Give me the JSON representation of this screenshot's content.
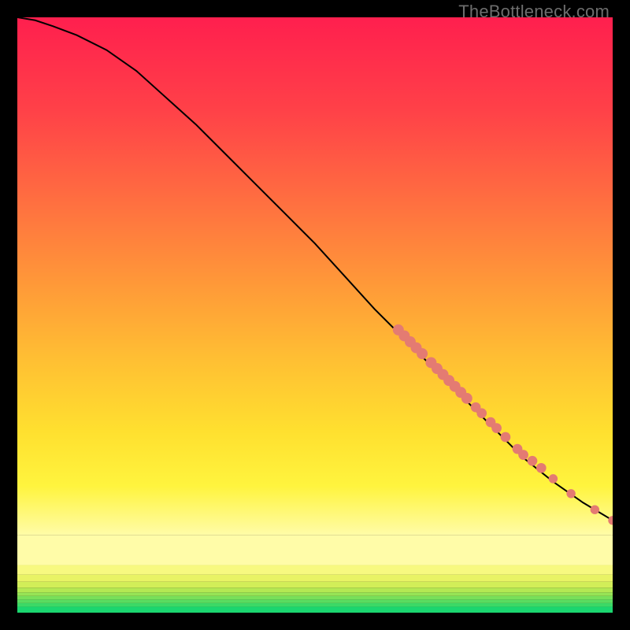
{
  "watermark": "TheBottleneck.com",
  "chart_data": {
    "type": "line",
    "title": "",
    "xlabel": "",
    "ylabel": "",
    "xlim": [
      0,
      100
    ],
    "ylim": [
      0,
      100
    ],
    "grid": false,
    "series": [
      {
        "name": "curve",
        "x": [
          0,
          3,
          6,
          10,
          15,
          20,
          25,
          30,
          35,
          40,
          45,
          50,
          55,
          60,
          65,
          70,
          75,
          80,
          85,
          90,
          95,
          100
        ],
        "y": [
          100,
          99.5,
          98.5,
          97,
          94.5,
          91,
          86.5,
          82,
          77,
          72,
          67,
          62,
          56.5,
          51,
          46,
          41,
          36,
          31,
          26,
          22,
          18.5,
          15.5
        ]
      }
    ],
    "markers": [
      {
        "x": 64,
        "y": 47.5,
        "r": 1.1
      },
      {
        "x": 65,
        "y": 46.5,
        "r": 1.1
      },
      {
        "x": 66,
        "y": 45.5,
        "r": 1.1
      },
      {
        "x": 67,
        "y": 44.5,
        "r": 1.1
      },
      {
        "x": 68,
        "y": 43.5,
        "r": 1.1
      },
      {
        "x": 69.5,
        "y": 42,
        "r": 1.1
      },
      {
        "x": 70.5,
        "y": 41,
        "r": 1.1
      },
      {
        "x": 71.5,
        "y": 40,
        "r": 1.1
      },
      {
        "x": 72.5,
        "y": 39,
        "r": 1.1
      },
      {
        "x": 73.5,
        "y": 38,
        "r": 1.1
      },
      {
        "x": 74.5,
        "y": 37,
        "r": 1.1
      },
      {
        "x": 75.5,
        "y": 36,
        "r": 1.1
      },
      {
        "x": 77,
        "y": 34.5,
        "r": 1.0
      },
      {
        "x": 78,
        "y": 33.5,
        "r": 1.0
      },
      {
        "x": 79.5,
        "y": 32,
        "r": 1.0
      },
      {
        "x": 80.5,
        "y": 31,
        "r": 1.0
      },
      {
        "x": 82,
        "y": 29.5,
        "r": 1.0
      },
      {
        "x": 84,
        "y": 27.5,
        "r": 1.0
      },
      {
        "x": 85,
        "y": 26.5,
        "r": 1.0
      },
      {
        "x": 86.5,
        "y": 25.5,
        "r": 1.0
      },
      {
        "x": 88,
        "y": 24.3,
        "r": 1.0
      },
      {
        "x": 90,
        "y": 22.5,
        "r": 0.9
      },
      {
        "x": 93,
        "y": 20,
        "r": 0.9
      },
      {
        "x": 97,
        "y": 17.3,
        "r": 0.9
      },
      {
        "x": 100,
        "y": 15.5,
        "r": 0.9
      }
    ],
    "bands": [
      {
        "y0": 0.0,
        "y1": 1.0,
        "color": "#1bd66f"
      },
      {
        "y0": 1.0,
        "y1": 1.6,
        "color": "#3cd966"
      },
      {
        "y0": 1.6,
        "y1": 2.2,
        "color": "#5adc60"
      },
      {
        "y0": 2.2,
        "y1": 2.8,
        "color": "#78e05a"
      },
      {
        "y0": 2.8,
        "y1": 3.4,
        "color": "#97e455"
      },
      {
        "y0": 3.4,
        "y1": 4.2,
        "color": "#b4e853"
      },
      {
        "y0": 4.2,
        "y1": 5.2,
        "color": "#d2ee58"
      },
      {
        "y0": 5.2,
        "y1": 6.4,
        "color": "#e8f365"
      },
      {
        "y0": 6.4,
        "y1": 8.0,
        "color": "#f7f980"
      },
      {
        "y0": 8.0,
        "y1": 13.0,
        "color": "#fffca8"
      }
    ],
    "gradient_stops": [
      {
        "offset": 0.0,
        "color": "#ff1f4e"
      },
      {
        "offset": 0.18,
        "color": "#ff4148"
      },
      {
        "offset": 0.36,
        "color": "#ff7040"
      },
      {
        "offset": 0.52,
        "color": "#ff9a38"
      },
      {
        "offset": 0.66,
        "color": "#ffbf33"
      },
      {
        "offset": 0.8,
        "color": "#ffe02f"
      },
      {
        "offset": 0.905,
        "color": "#fff43e"
      },
      {
        "offset": 1.0,
        "color": "#fffca8"
      }
    ],
    "marker_color": "#e47b72",
    "curve_color": "#000000"
  }
}
